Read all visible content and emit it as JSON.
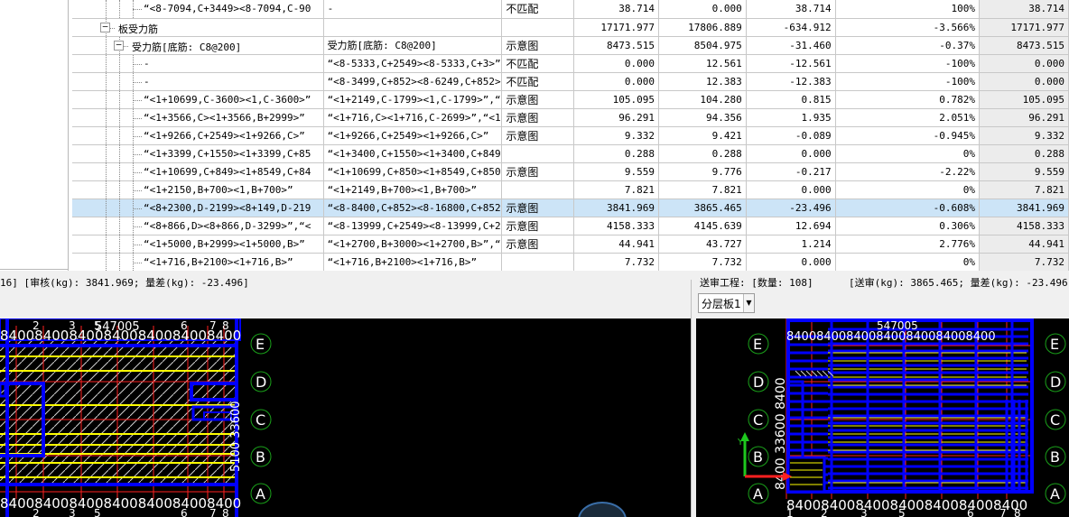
{
  "grid": {
    "rows": [
      {
        "level": 3,
        "label": "“<8-7094,C+3449><8-7094,C-90",
        "desc": "-",
        "mark": "不匹配",
        "v1": "38.714",
        "v2": "0.000",
        "v3": "38.714",
        "pct": "100%",
        "v5": "38.714",
        "selected": false
      },
      {
        "level": 1,
        "toggle": "−",
        "label": "板受力筋",
        "desc": "",
        "mark": "",
        "v1": "17171.977",
        "v2": "17806.889",
        "v3": "-634.912",
        "pct": "-3.566%",
        "v5": "17171.977",
        "selected": false
      },
      {
        "level": 2,
        "toggle": "−",
        "label": "受力筋[底筋: C8@200]",
        "desc": "受力筋[底筋: C8@200]",
        "mark": "示意图",
        "v1": "8473.515",
        "v2": "8504.975",
        "v3": "-31.460",
        "pct": "-0.37%",
        "v5": "8473.515",
        "selected": false
      },
      {
        "level": 3,
        "label": "-",
        "desc": "“<8-5333,C+2549><8-5333,C+3>”",
        "mark": "不匹配",
        "v1": "0.000",
        "v2": "12.561",
        "v3": "-12.561",
        "pct": "-100%",
        "v5": "0.000",
        "selected": false
      },
      {
        "level": 3,
        "label": "-",
        "desc": "“<8-3499,C+852><8-6249,C+852>”",
        "mark": "不匹配",
        "v1": "0.000",
        "v2": "12.383",
        "v3": "-12.383",
        "pct": "-100%",
        "v5": "0.000",
        "selected": false
      },
      {
        "level": 3,
        "label": "“<1+10699,C-3600><1,C-3600>”",
        "desc": "“<1+2149,C-1799><1,C-1799>”,“",
        "mark": "示意图",
        "v1": "105.095",
        "v2": "104.280",
        "v3": "0.815",
        "pct": "0.782%",
        "v5": "105.095",
        "selected": false
      },
      {
        "level": 3,
        "label": "“<1+3566,C><1+3566,B+2999>”",
        "desc": "“<1+716,C><1+716,C-2699>”,“<1",
        "mark": "示意图",
        "v1": "96.291",
        "v2": "94.356",
        "v3": "1.935",
        "pct": "2.051%",
        "v5": "96.291",
        "selected": false
      },
      {
        "level": 3,
        "label": "“<1+9266,C+2549><1+9266,C>”",
        "desc": "“<1+9266,C+2549><1+9266,C>”",
        "mark": "示意图",
        "v1": "9.332",
        "v2": "9.421",
        "v3": "-0.089",
        "pct": "-0.945%",
        "v5": "9.332",
        "selected": false
      },
      {
        "level": 3,
        "label": "“<1+3399,C+1550><1+3399,C+85",
        "desc": "“<1+3400,C+1550><1+3400,C+849",
        "mark": "",
        "v1": "0.288",
        "v2": "0.288",
        "v3": "0.000",
        "pct": "0%",
        "v5": "0.288",
        "selected": false
      },
      {
        "level": 3,
        "label": "“<1+10699,C+849><1+8549,C+84",
        "desc": "“<1+10699,C+850><1+8549,C+850",
        "mark": "示意图",
        "v1": "9.559",
        "v2": "9.776",
        "v3": "-0.217",
        "pct": "-2.22%",
        "v5": "9.559",
        "selected": false
      },
      {
        "level": 3,
        "label": "“<1+2150,B+700><1,B+700>”",
        "desc": "“<1+2149,B+700><1,B+700>”",
        "mark": "",
        "v1": "7.821",
        "v2": "7.821",
        "v3": "0.000",
        "pct": "0%",
        "v5": "7.821",
        "selected": false
      },
      {
        "level": 3,
        "label": "“<8+2300,D-2199><8+149,D-219",
        "desc": "“<8-8400,C+852><8-16800,C+852",
        "mark": "示意图",
        "v1": "3841.969",
        "v2": "3865.465",
        "v3": "-23.496",
        "pct": "-0.608%",
        "v5": "3841.969",
        "selected": true
      },
      {
        "level": 3,
        "label": "“<8+866,D><8+866,D-3299>”,“<",
        "desc": "“<8-13999,C+2549><8-13999,C+2",
        "mark": "示意图",
        "v1": "4158.333",
        "v2": "4145.639",
        "v3": "12.694",
        "pct": "0.306%",
        "v5": "4158.333",
        "selected": false
      },
      {
        "level": 3,
        "label": "“<1+5000,B+2999><1+5000,B>”",
        "desc": "“<1+2700,B+3000><1+2700,B>”,“",
        "mark": "示意图",
        "v1": "44.941",
        "v2": "43.727",
        "v3": "1.214",
        "pct": "2.776%",
        "v5": "44.941",
        "selected": false
      },
      {
        "level": 3,
        "label": "“<1+716,B+2100><1+716,B>”",
        "desc": "“<1+716,B+2100><1+716,B>”",
        "mark": "",
        "v1": "7.732",
        "v2": "7.732",
        "v3": "0.000",
        "pct": "0%",
        "v5": "7.732",
        "selected": false
      }
    ]
  },
  "status": {
    "left_text": "16]     [审核(kg): 3841.969; 量差(kg): -23.496]",
    "right_title": "送审工程: [数量: 108]",
    "right_text": "[送审(kg): 3865.465; 量差(kg): -23.496]"
  },
  "layer_select": {
    "value": "分层板1"
  },
  "cad_left": {
    "axis_rows": [
      "E",
      "D",
      "C",
      "B",
      "A"
    ],
    "axis_cols": [
      "2",
      "3",
      "5",
      "6",
      "7",
      "8"
    ],
    "top_dims": "8400840084008400840084008400",
    "bottom_dims": "8400840084008400840084008400",
    "col_marker": "547005",
    "right_dims": "5100 33600"
  },
  "cad_right": {
    "axis_rows": [
      "E",
      "D",
      "C",
      "B",
      "A"
    ],
    "axis_cols": [
      "1",
      "2",
      "3",
      "5",
      "6",
      "7",
      "8"
    ],
    "top_dims": "8400840084008400840084008400",
    "bottom_dims": "8400840084008400840084008400",
    "col_marker": "547005",
    "left_dims": "8400 33600 8400"
  },
  "colors": {
    "selected_row": "#cce4f7",
    "rebar": "#0000ff",
    "yellow_bar": "#ffff00",
    "axis_green": "#1aa01a",
    "grid_red": "#ff2020"
  }
}
